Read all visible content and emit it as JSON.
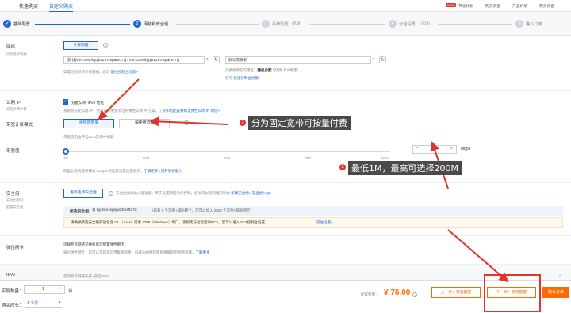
{
  "top": {
    "tabs": [
      "快速购买",
      "自定义购买"
    ],
    "right": [
      "节省计划",
      "购买云盘",
      "产品价格",
      "购买云盘"
    ],
    "hot": "NEW"
  },
  "steps": [
    {
      "n": "✔",
      "label": "基础配置"
    },
    {
      "n": "2",
      "label": "网络和安全组"
    },
    {
      "n": "3",
      "label": "系统配置",
      "note": "(选填)"
    },
    {
      "n": "4",
      "label": "分组设置",
      "note": "(选填)"
    },
    {
      "n": "5",
      "label": "确认订单"
    }
  ],
  "network": {
    "label": "网络",
    "sub": "如何选择网络",
    "type_btn": "专有网络",
    "vpc": "[默认]vpc-2zeckjyyb12m78pamo7vj / vpc-2zeckjyyb12m78pamo7vj",
    "vswitch": "默认交换机",
    "vpc_hint": "如需创建新的专有网络，您可",
    "vpc_link": "前往控制台创建>",
    "vs_hint1": "交换机所在可用区：",
    "vs_zone": "随机分配",
    "vs_hint2": "可用私有IP数量：",
    "vs_ip": "-",
    "vs_hint3": "您可",
    "vs_link": "前往控制台创建>"
  },
  "ip": {
    "label": "公网 IP",
    "sub": "如何计费计算",
    "checkbox": "分配公网 IPv4 地址",
    "desc": "系统会分配公网 IP，也可采用更加灵活的弹性公网 IP 方案，了解",
    "desc_link": "如何配置并绑定弹性公网 IP 地址>"
  },
  "billing": {
    "label": "带宽计费模式",
    "fixed": "按固定带宽",
    "traffic": "按使用流量",
    "hint": "带宽费用由开启ECS实例中扣取"
  },
  "bandwidth": {
    "label": "带宽值",
    "ticks": [
      "1M",
      "25M",
      "50M",
      "75M",
      "100M"
    ],
    "value": "1",
    "unit": "Mbps",
    "hint": "阿里云免费提供最高 5Gbps 的恶意流量攻击防护，",
    "hint_link": "了解更多",
    "hint_link2": "提升防护能力"
  },
  "security": {
    "label": "安全组",
    "sub1": "安全组限制",
    "sub2": "配置安全组",
    "btn": "重新选择安全组",
    "hint": "安全组类似防火墙功能，用于设置网络访问控制，您也可以到管理控制台",
    "hint_link1": "新建安全组>",
    "hint_link2": "安全组FAQ>",
    "selected_label": "所选安全组：",
    "selected": "1) sg-2ze4sgnjvorbnsftu7u",
    "selected_hint": "(日有 0 个实例+辅助网卡，还可以加入 2000 个实例+辅助网卡)",
    "rules": "请确保所选安全组开放包含 22（Linux）或者 3389（Windows）端口，否则无法远程登录ECS。您可以进入ECS控制台设置。",
    "rules_link": "前往设置>"
  },
  "eni": {
    "label": "弹性网卡",
    "line1": "选择专有网络交换机后可配置弹性网卡",
    "line2": "通过弹性网卡，您可以实现高可用集群搭建、低成本故障转移和精细化的网络管理。",
    "link": "了解更多"
  },
  "ipv6": {
    "label": "IPv6",
    "line": "您的专有网络未开 (开启IPv6)"
  },
  "footer": {
    "qty_label": "实例数量：",
    "qty": "1",
    "qty_unit": "台",
    "duration_label": "购买时长：",
    "duration": "1 个月",
    "price_label": "配置费用：",
    "price": "¥ 76.00",
    "prev": "上一步：基础配置",
    "next": "下一步：系统配置",
    "confirm": "确认订单"
  },
  "annotations": {
    "a1_n": "1",
    "a1": "分为固定宽带可按量付费",
    "a2_n": "2",
    "a2": "最低1M，最高可选择200M"
  }
}
